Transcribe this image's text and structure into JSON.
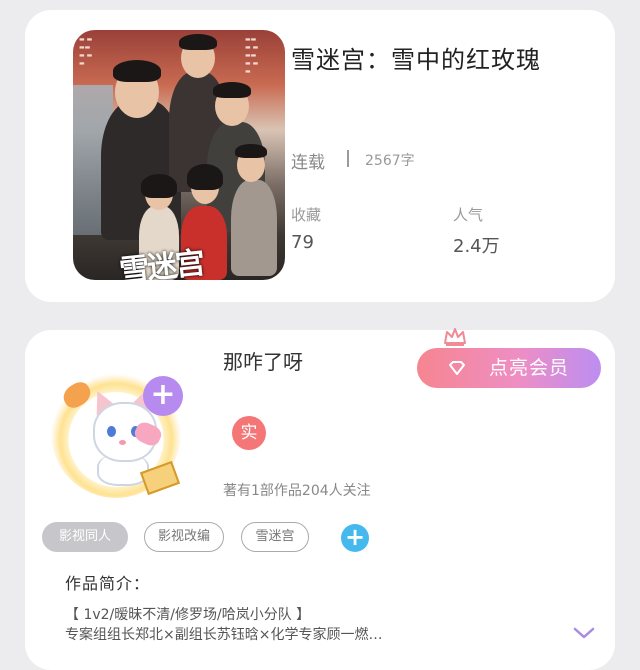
{
  "book": {
    "title": "雪迷宫：雪中的红玫瑰",
    "status": "连载",
    "word_count": "2567字",
    "favorites_label": "收藏",
    "favorites_value": "79",
    "popularity_label": "人气",
    "popularity_value": "2.4万",
    "cover_title_art": "雪迷宫"
  },
  "author": {
    "name": "那咋了呀",
    "verified_badge": "实",
    "stats": "著有1部作品204人关注",
    "follow_symbol": "+",
    "vip_button_label": "点亮会员"
  },
  "tags": {
    "items": [
      "影视同人",
      "影视改编",
      "雪迷宫"
    ],
    "add_symbol": "+"
  },
  "intro": {
    "label": "作品简介：",
    "line1": "【 1v2/暧昧不清/修罗场/哈岚小分队 】",
    "line2": "专案组组长郑北×副组长苏钰晗×化学专家顾一燃…"
  },
  "colors": {
    "accent_purple": "#b78af0",
    "vip_gradient_start": "#f6858f",
    "vip_gradient_end": "#bb8ef2",
    "verified_red": "#f47677",
    "add_tag_blue": "#45b9ee"
  }
}
